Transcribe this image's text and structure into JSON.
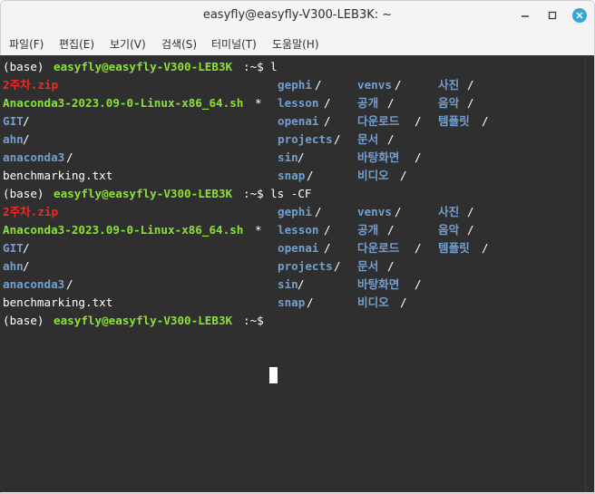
{
  "window": {
    "title": "easyfly@easyfly-V300-LEB3K: ~",
    "controls": {
      "minimize_icon": "minimize-icon",
      "maximize_icon": "maximize-icon",
      "close_icon": "close-icon"
    }
  },
  "menu": [
    "파일(F)",
    "편집(E)",
    "보기(V)",
    "검색(S)",
    "터미널(T)",
    "도움말(H)"
  ],
  "prompt": {
    "base": "(base) ",
    "user_host": "easyfly@easyfly-V300-LEB3K",
    "path": ":~$ "
  },
  "commands": {
    "first": "l",
    "second": "ls -CF"
  },
  "listing": {
    "col1": [
      "2주차.zip",
      "Anaconda3-2023.09-0-Linux-x86_64.sh",
      "GIT",
      "ahn",
      "anaconda3",
      "benchmarking.txt"
    ],
    "col1_suffix": [
      "",
      "*",
      "/",
      "/",
      "/",
      ""
    ],
    "col2": [
      "gephi",
      "lesson",
      "openai",
      "projects",
      "sin",
      "snap"
    ],
    "col3": [
      "venvs",
      "공개",
      "다운로드",
      "문서",
      "바탕화면",
      "비디오"
    ],
    "col4": [
      "사진",
      "음악",
      "템플릿",
      "",
      "",
      ""
    ]
  },
  "colors": {
    "terminal_bg": "#2f2f2f",
    "prompt_user": "#8ae234",
    "directory": "#729fcf",
    "archive": "#ef2929",
    "executable": "#8ae234",
    "text": "#ffffff",
    "close_button": "#35a4d9"
  }
}
